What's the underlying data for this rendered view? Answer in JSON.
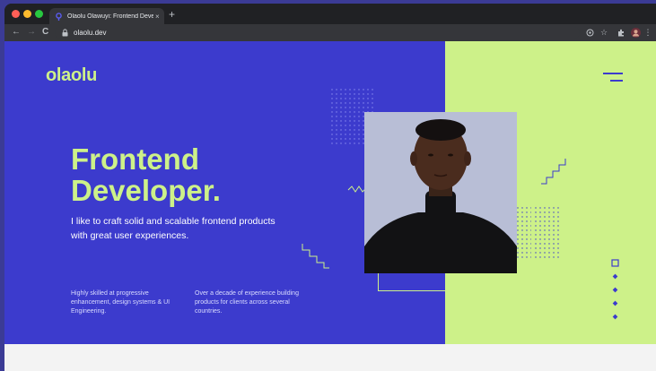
{
  "browser": {
    "tab_title": "Olaolu Olawuyi: Frontend Developer",
    "tab_close": "×",
    "new_tab": "+",
    "url": "olaolu.dev",
    "nav": {
      "back": "←",
      "forward": "→",
      "reload": "C"
    },
    "toolbar_icons": [
      "google-lens-icon",
      "star-icon",
      "extensions-icon",
      "profile-avatar"
    ],
    "more": "⋮"
  },
  "site": {
    "logo": "olaolu",
    "headline_line1": "Frontend",
    "headline_line2": "Developer.",
    "subtitle": "I like to craft solid and scalable frontend products with great user experiences.",
    "features": [
      "Highly skilled at progressive enhancement, design systems & UI Engineering.",
      "Over a decade of experience building products for clients across several countries."
    ]
  },
  "colors": {
    "brand_blue": "#3c3bcd",
    "brand_lime": "#cdf189",
    "chrome_dark": "#202124"
  }
}
